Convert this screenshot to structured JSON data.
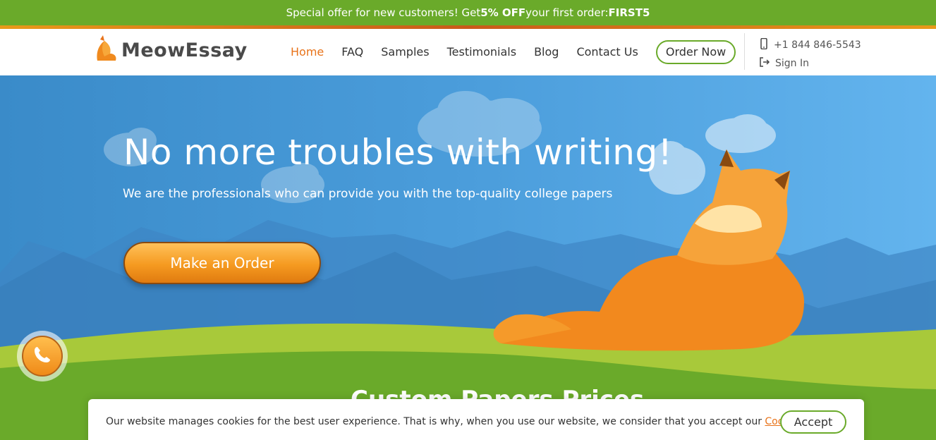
{
  "promo": {
    "text": "Special offer for new customers! Get ",
    "discount": "5% OFF",
    "text2": " your first order: ",
    "code": "FIRST5"
  },
  "header": {
    "logo_text": "MeowEssay",
    "nav": [
      {
        "label": "Home",
        "active": true
      },
      {
        "label": "FAQ"
      },
      {
        "label": "Samples"
      },
      {
        "label": "Testimonials"
      },
      {
        "label": "Blog"
      },
      {
        "label": "Contact Us"
      }
    ],
    "order_now": "Order Now",
    "phone": "+1 844 846-5543",
    "sign_in": "Sign In"
  },
  "hero": {
    "headline": "No more troubles with writing!",
    "subhead": "We are the professionals who can provide you with the top-quality college papers",
    "cta": "Make an Order",
    "section_title": "Custom Papers Prices"
  },
  "cookie": {
    "text": "Our website manages cookies for the best user experience. That is why, when you use our website, we consider that you accept our ",
    "link": "Cookie Policy",
    "period": ".",
    "accept": "Accept"
  },
  "colors": {
    "brand_green": "#6aaa2a",
    "accent_orange": "#e8731a",
    "sky": "#4b9ddb"
  },
  "icons": [
    "fox-logo-icon",
    "mobile-phone-icon",
    "sign-in-icon",
    "phone-call-icon"
  ]
}
